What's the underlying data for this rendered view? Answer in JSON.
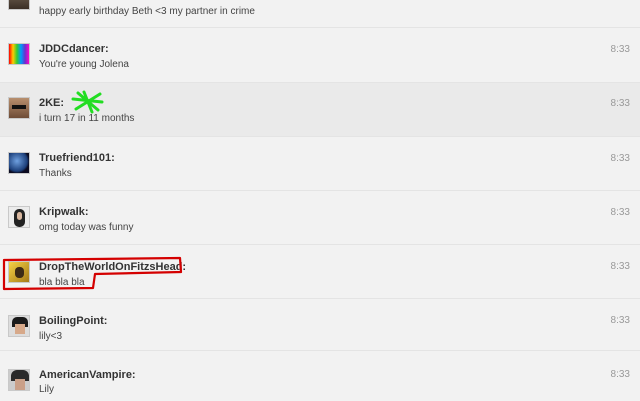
{
  "messages": [
    {
      "username": "",
      "text": "happy early birthday Beth <3 my partner in crime",
      "time": "",
      "avatar": "dark-avatar"
    },
    {
      "username": "JDDCdancer:",
      "text": "You're young Jolena",
      "time": "8:33",
      "avatar": "rainbow-avatar"
    },
    {
      "username": "2KE:",
      "text": "i turn 17 in 11 months",
      "time": "8:33",
      "avatar": "sunglasses-avatar"
    },
    {
      "username": "Truefriend101:",
      "text": "Thanks",
      "time": "8:33",
      "avatar": "earth-avatar"
    },
    {
      "username": "Kripwalk:",
      "text": "omg today was funny",
      "time": "8:33",
      "avatar": "woman-avatar"
    },
    {
      "username": "DropTheWorldOnFitzsHead:",
      "text": "bla bla bla",
      "time": "8:33",
      "avatar": "yellow-photo-avatar"
    },
    {
      "username": "BoilingPoint:",
      "text": "lily<3",
      "time": "8:33",
      "avatar": "dark-hair-avatar"
    },
    {
      "username": "AmericanVampire:",
      "text": "Lily",
      "time": "8:33",
      "avatar": "dark-hair-avatar-2"
    }
  ],
  "colors": {
    "annotation_red": "#d40000",
    "annotation_green": "#22dd22"
  }
}
